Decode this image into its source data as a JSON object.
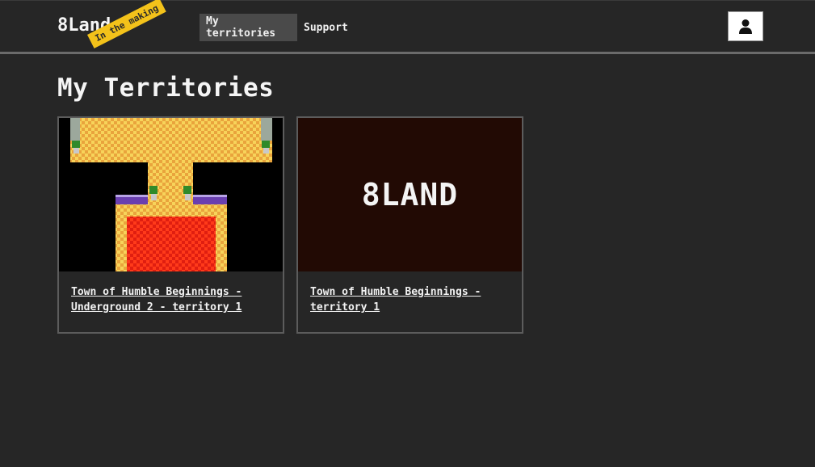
{
  "header": {
    "brand": "8Land",
    "ribbon": "In the making",
    "nav": [
      {
        "label": "My territories",
        "active": true
      },
      {
        "label": "Support",
        "active": false
      }
    ],
    "user_icon": "user-icon"
  },
  "main": {
    "title": "My Territories",
    "cards": [
      {
        "link": "Town of Humble Beginnings - Underground 2 - territory 1",
        "thumbnail": "map-preview"
      },
      {
        "link": "Town of Humble Beginnings - territory 1",
        "thumbnail_text": "8LAND"
      }
    ]
  },
  "colors": {
    "background": "#262626",
    "ribbon": "#f3c21a",
    "nav_active": "#4a4a4a",
    "placeholder_bg": "#220a04"
  }
}
